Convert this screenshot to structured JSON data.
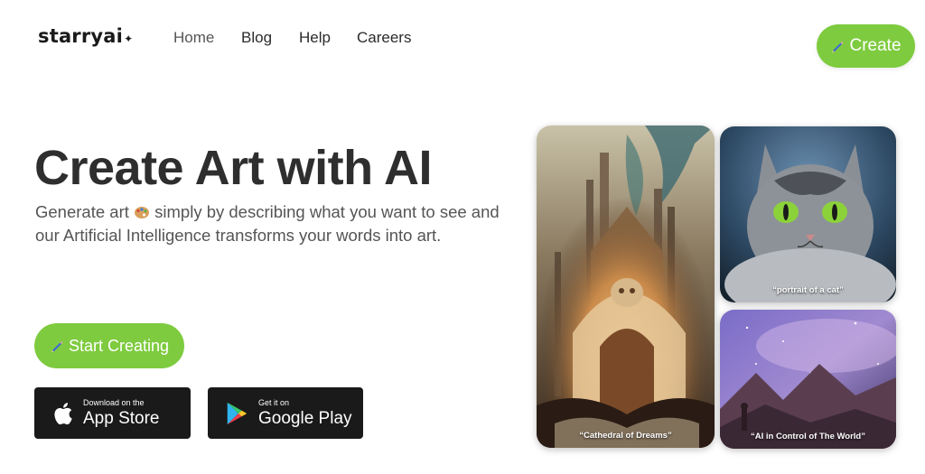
{
  "header": {
    "logo_text": "starryai",
    "logo_sparkle": "✦",
    "nav": [
      "Home",
      "Blog",
      "Help",
      "Careers"
    ],
    "create_label": "Create"
  },
  "hero": {
    "title": "Create Art with AI",
    "subtitle_part1": "Generate art",
    "subtitle_part2": "simply by describing what you want to see and our Artificial Intelligence transforms your words into art.",
    "start_label": "Start Creating"
  },
  "stores": {
    "app_small": "Download on the",
    "app_big": "App Store",
    "play_small": "Get it on",
    "play_big": "Google Play"
  },
  "gallery": {
    "cathedral_caption": "“Cathedral of Dreams”",
    "cat_caption": "“portrait of a cat”",
    "space_caption": "“AI in Control of The World”"
  },
  "colors": {
    "accent_green": "#7ecb3f",
    "store_black": "#1a1a1a"
  },
  "icons": [
    "pencil-icon",
    "palette-icon",
    "apple-icon",
    "google-play-icon"
  ]
}
